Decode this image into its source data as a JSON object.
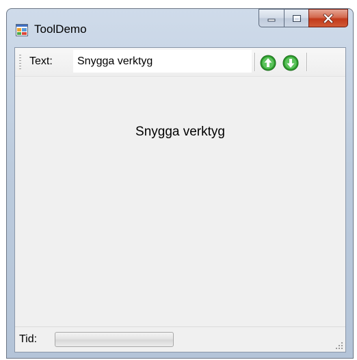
{
  "window": {
    "title": "ToolDemo",
    "icon": "application-window-icon",
    "caption_buttons": [
      "minimize-icon",
      "maximize-icon",
      "close-icon"
    ]
  },
  "toolbar": {
    "text_label": "Text:",
    "text_value": "Snygga verktyg",
    "buttons": [
      {
        "name": "up-arrow-button",
        "icon": "green-up-arrow-icon"
      },
      {
        "name": "down-arrow-button",
        "icon": "green-down-arrow-icon"
      }
    ]
  },
  "main": {
    "display_text": "Snygga verktyg"
  },
  "status": {
    "label": "Tid:",
    "progress": 0
  },
  "colors": {
    "button_green": "#2e9e2e",
    "close_red": "#c23a1b",
    "client_bg": "#f0f0f0"
  }
}
